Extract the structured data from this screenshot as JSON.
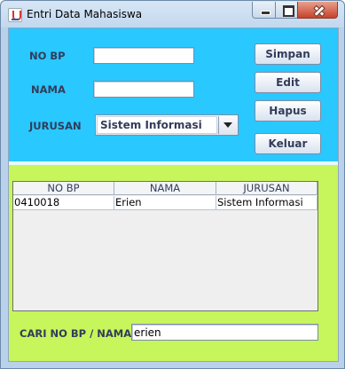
{
  "window": {
    "title": "Entri Data Mahasiswa"
  },
  "form": {
    "nobp_label": "NO BP",
    "nobp_value": "",
    "nama_label": "NAMA",
    "nama_value": "",
    "jurusan_label": "JURUSAN",
    "jurusan_selected": "Sistem Informasi"
  },
  "buttons": {
    "simpan": "Simpan",
    "edit": "Edit",
    "hapus": "Hapus",
    "keluar": "Keluar"
  },
  "table": {
    "columns": [
      "NO BP",
      "NAMA",
      "JURUSAN"
    ],
    "rows": [
      [
        "0410018",
        "Erien",
        "Sistem Informasi"
      ]
    ]
  },
  "search": {
    "label": "CARI NO BP / NAMA",
    "value": "erien"
  },
  "colors": {
    "top_panel": "#29c8ff",
    "bottom_panel": "#c7f55c"
  }
}
